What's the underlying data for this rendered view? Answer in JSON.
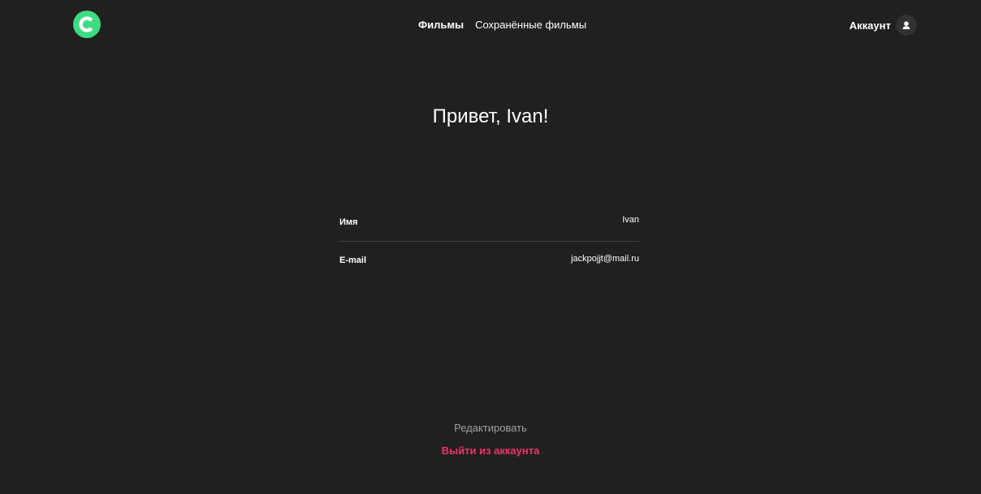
{
  "colors": {
    "background": "#202020",
    "logo_accent": "#3ddc84",
    "logout": "#ee3465",
    "muted": "#a0a0a0",
    "divider": "#424242"
  },
  "header": {
    "logo_icon": "circle-c-logo",
    "nav": {
      "movies_label": "Фильмы",
      "saved_movies_label": "Сохранённые фильмы"
    },
    "account": {
      "label": "Аккаунт",
      "icon": "user-icon"
    }
  },
  "profile": {
    "greeting": "Привет, Ivan!",
    "fields": [
      {
        "label": "Имя",
        "value": "Ivan"
      },
      {
        "label": "E-mail",
        "value": "jackpojjt@mail.ru"
      }
    ],
    "edit_label": "Редактировать",
    "logout_label": "Выйти из аккаунта"
  }
}
